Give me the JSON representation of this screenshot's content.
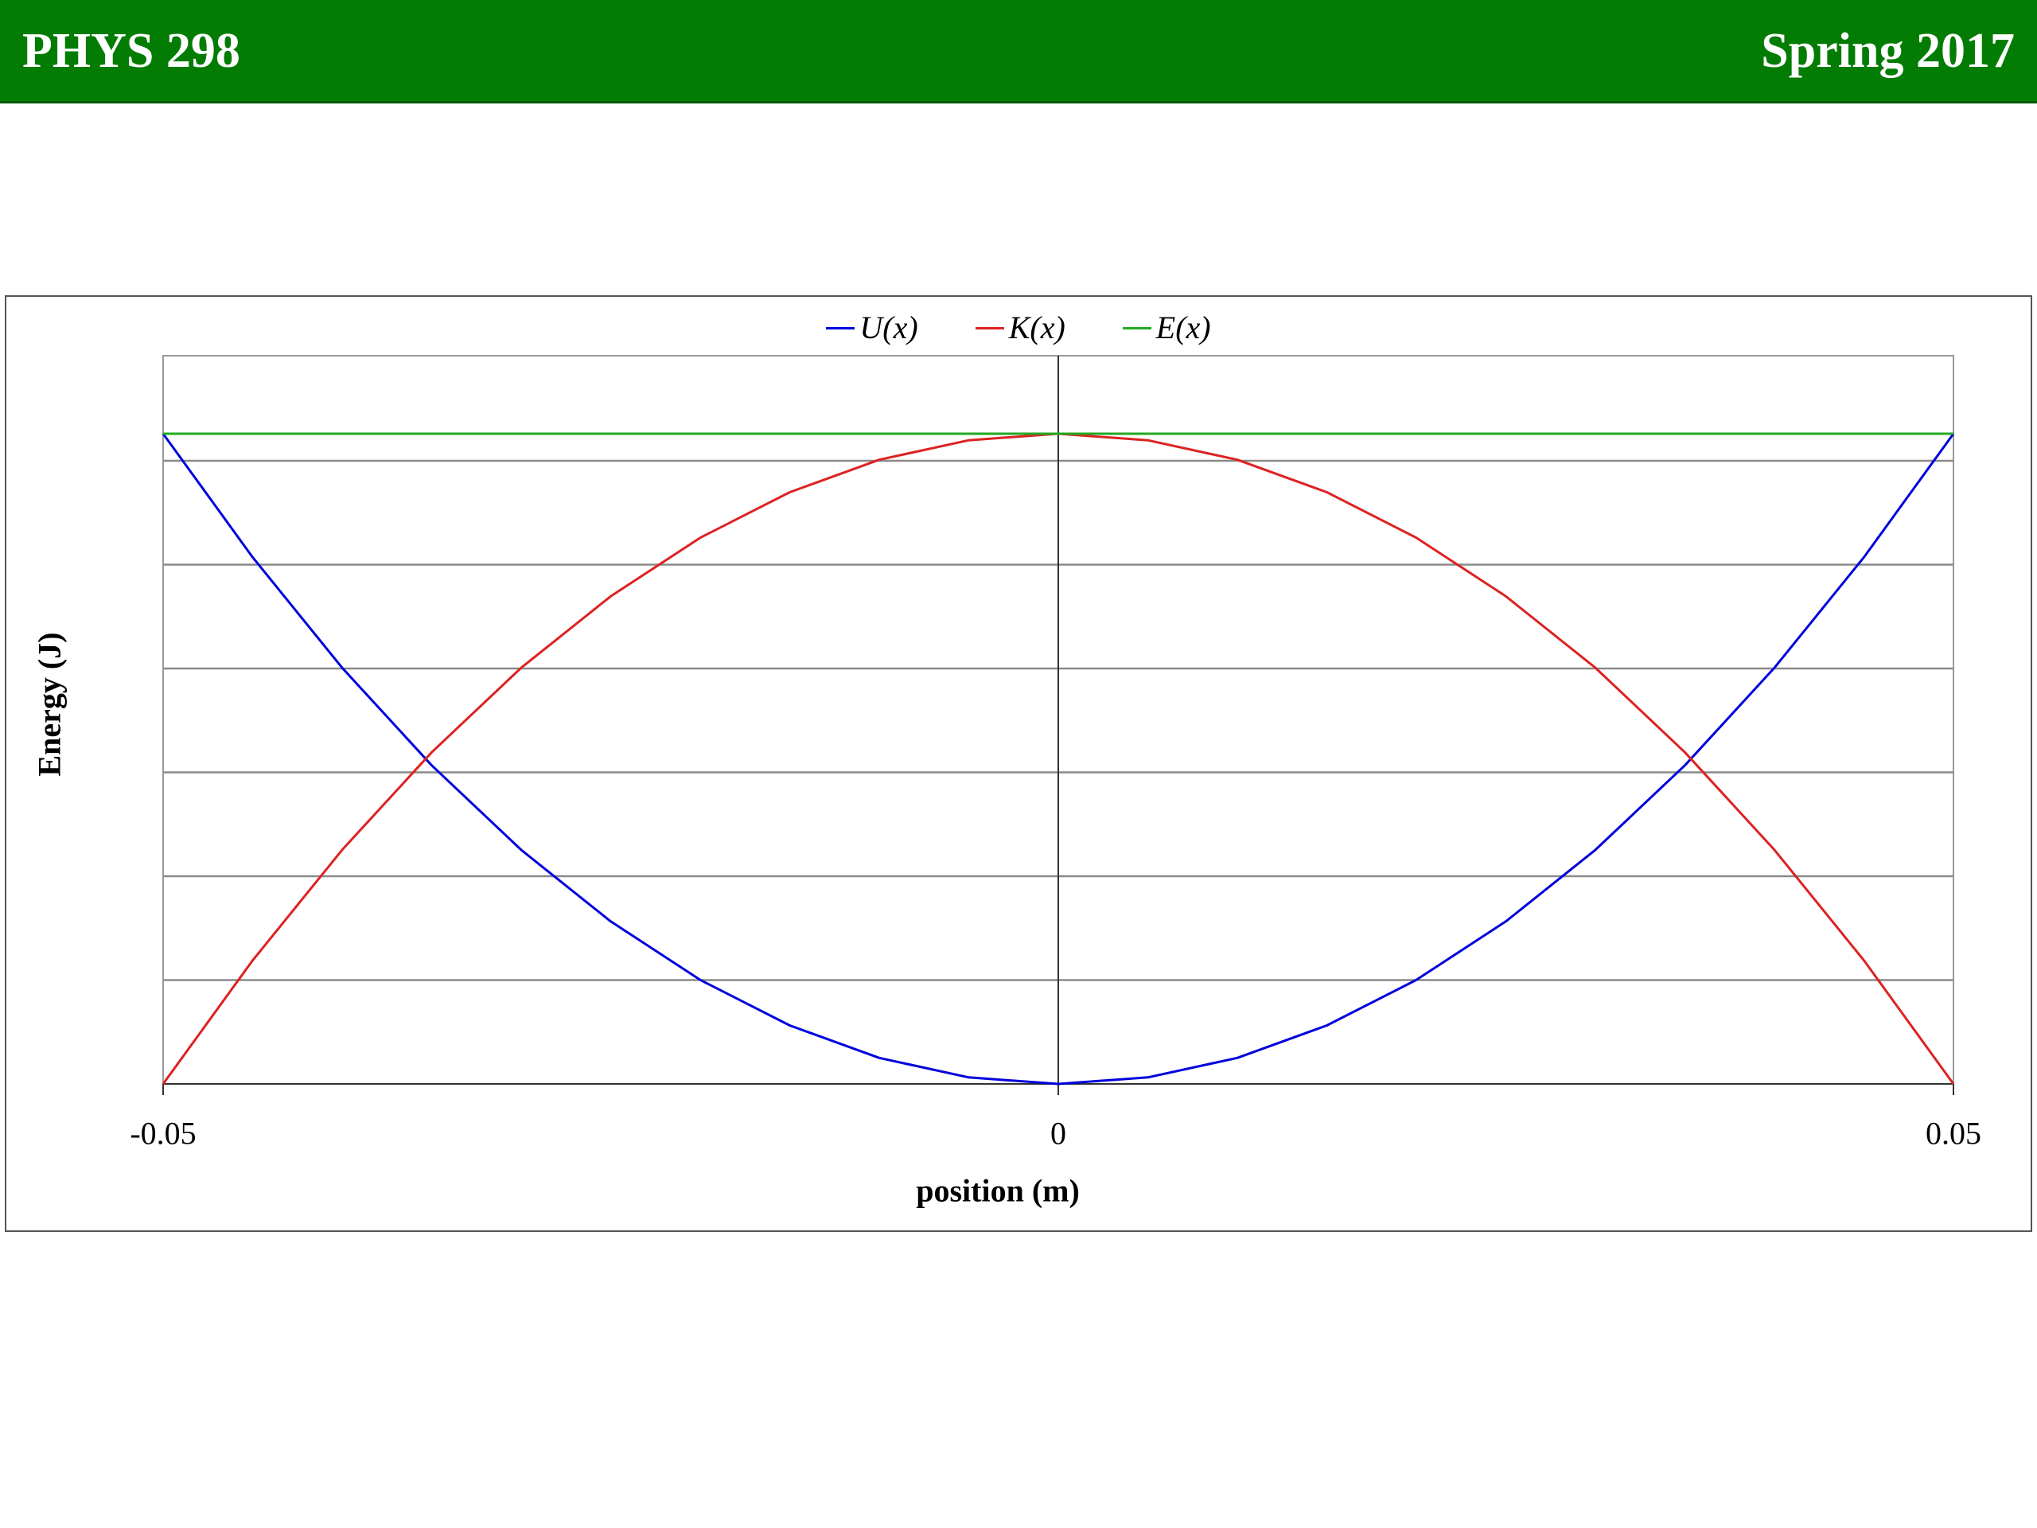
{
  "header": {
    "course": "PHYS 298",
    "term": "Spring 2017"
  },
  "chart_data": {
    "type": "line",
    "title": "",
    "xlabel": "position (m)",
    "ylabel": "Energy (J)",
    "xlim": [
      -0.05,
      0.05
    ],
    "ylim": [
      0,
      1
    ],
    "x_ticks": [
      "-0.05",
      "0",
      "0.05"
    ],
    "y_gridlines": 6,
    "grid": true,
    "legend_position": "top-center",
    "series": [
      {
        "name": "U(x)",
        "color": "#0000dd",
        "x": [
          -0.05,
          -0.045,
          -0.04,
          -0.035,
          -0.03,
          -0.025,
          -0.02,
          -0.015,
          -0.01,
          -0.005,
          0,
          0.005,
          0.01,
          0.015,
          0.02,
          0.025,
          0.03,
          0.035,
          0.04,
          0.045,
          0.05
        ],
        "y": [
          1.0,
          0.81,
          0.64,
          0.49,
          0.36,
          0.25,
          0.16,
          0.09,
          0.04,
          0.01,
          0.0,
          0.01,
          0.04,
          0.09,
          0.16,
          0.25,
          0.36,
          0.49,
          0.64,
          0.81,
          1.0
        ]
      },
      {
        "name": "K(x)",
        "color": "#dd2222",
        "x": [
          -0.05,
          -0.045,
          -0.04,
          -0.035,
          -0.03,
          -0.025,
          -0.02,
          -0.015,
          -0.01,
          -0.005,
          0,
          0.005,
          0.01,
          0.015,
          0.02,
          0.025,
          0.03,
          0.035,
          0.04,
          0.045,
          0.05
        ],
        "y": [
          0.0,
          0.19,
          0.36,
          0.51,
          0.64,
          0.75,
          0.84,
          0.91,
          0.96,
          0.99,
          1.0,
          0.99,
          0.96,
          0.91,
          0.84,
          0.75,
          0.64,
          0.51,
          0.36,
          0.19,
          0.0
        ]
      },
      {
        "name": "E(x)",
        "color": "#22aa22",
        "x": [
          -0.05,
          0.05
        ],
        "y": [
          1.0,
          1.0
        ]
      }
    ]
  }
}
